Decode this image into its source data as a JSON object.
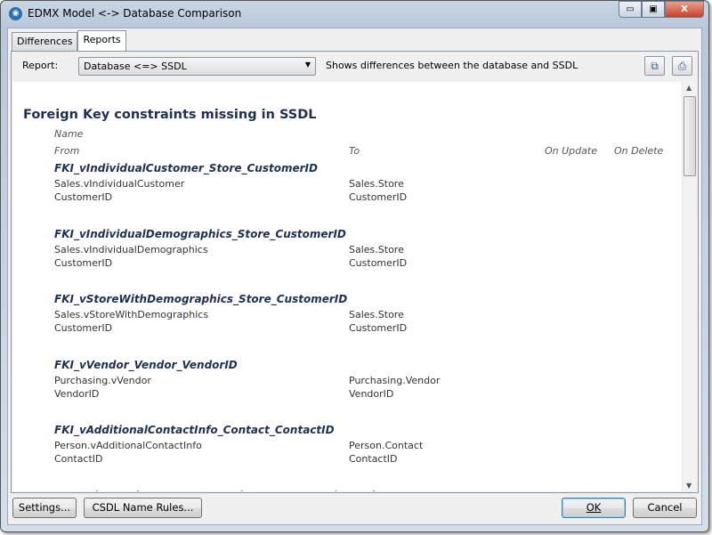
{
  "window": {
    "title": "EDMX Model <-> Database Comparison",
    "minimize": "▭",
    "maximize": "▣",
    "close": "X"
  },
  "tabs": [
    {
      "label": "Differences"
    },
    {
      "label": "Reports"
    }
  ],
  "toolbar": {
    "report_label": "Report:",
    "report_value": "Database <=> SSDL",
    "description": "Shows differences between the database and SSDL",
    "export_icon": "export-icon",
    "print_icon": "print-icon"
  },
  "report": {
    "heading": "Foreign Key constraints missing in SSDL",
    "columns": {
      "name": "Name",
      "from": "From",
      "to": "To",
      "on_update": "On Update",
      "on_delete": "On Delete"
    },
    "items": [
      {
        "name": "FKI_vIndividualCustomer_Store_CustomerID",
        "from_table": "Sales.vIndividualCustomer",
        "from_col": "CustomerID",
        "to_table": "Sales.Store",
        "to_col": "CustomerID"
      },
      {
        "name": "FKI_vIndividualDemographics_Store_CustomerID",
        "from_table": "Sales.vIndividualDemographics",
        "from_col": "CustomerID",
        "to_table": "Sales.Store",
        "to_col": "CustomerID"
      },
      {
        "name": "FKI_vStoreWithDemographics_Store_CustomerID",
        "from_table": "Sales.vStoreWithDemographics",
        "from_col": "CustomerID",
        "to_table": "Sales.Store",
        "to_col": "CustomerID"
      },
      {
        "name": "FKI_vVendor_Vendor_VendorID",
        "from_table": "Purchasing.vVendor",
        "from_col": "VendorID",
        "to_table": "Purchasing.Vendor",
        "to_col": "VendorID"
      },
      {
        "name": "FKI_vAdditionalContactInfo_Contact_ContactID",
        "from_table": "Person.vAdditionalContactInfo",
        "from_col": "ContactID",
        "to_table": "Person.Contact",
        "to_col": "ContactID"
      },
      {
        "name": "FKI_SalesTerritory_CountryRegion_CountryRegionCode"
      }
    ]
  },
  "buttons": {
    "settings": "Settings...",
    "csdl": "CSDL Name Rules...",
    "ok": "OK",
    "cancel": "Cancel"
  }
}
